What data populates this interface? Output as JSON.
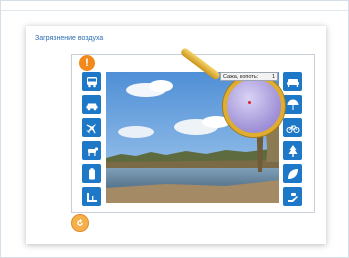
{
  "page": {
    "title": "Загрязнение воздуха"
  },
  "alert": {
    "glyph": "!"
  },
  "left_buttons": [
    {
      "icon": "bus-icon"
    },
    {
      "icon": "car-icon"
    },
    {
      "icon": "airplane-icon"
    },
    {
      "icon": "cow-icon"
    },
    {
      "icon": "battery-icon"
    },
    {
      "icon": "factory-icon"
    }
  ],
  "right_buttons": [
    {
      "icon": "sofa-icon"
    },
    {
      "icon": "umbrella-icon"
    },
    {
      "icon": "bicycle-icon"
    },
    {
      "icon": "tree-icon"
    },
    {
      "icon": "leaf-icon"
    },
    {
      "icon": "hand-icon"
    }
  ],
  "magnifier": {
    "label": "Сажа, копоть:",
    "value": "1"
  },
  "colors": {
    "accent": "#1d78c7",
    "title": "#2a6db5",
    "alert": "#f18a1c",
    "lens": "#9e8fd6"
  }
}
